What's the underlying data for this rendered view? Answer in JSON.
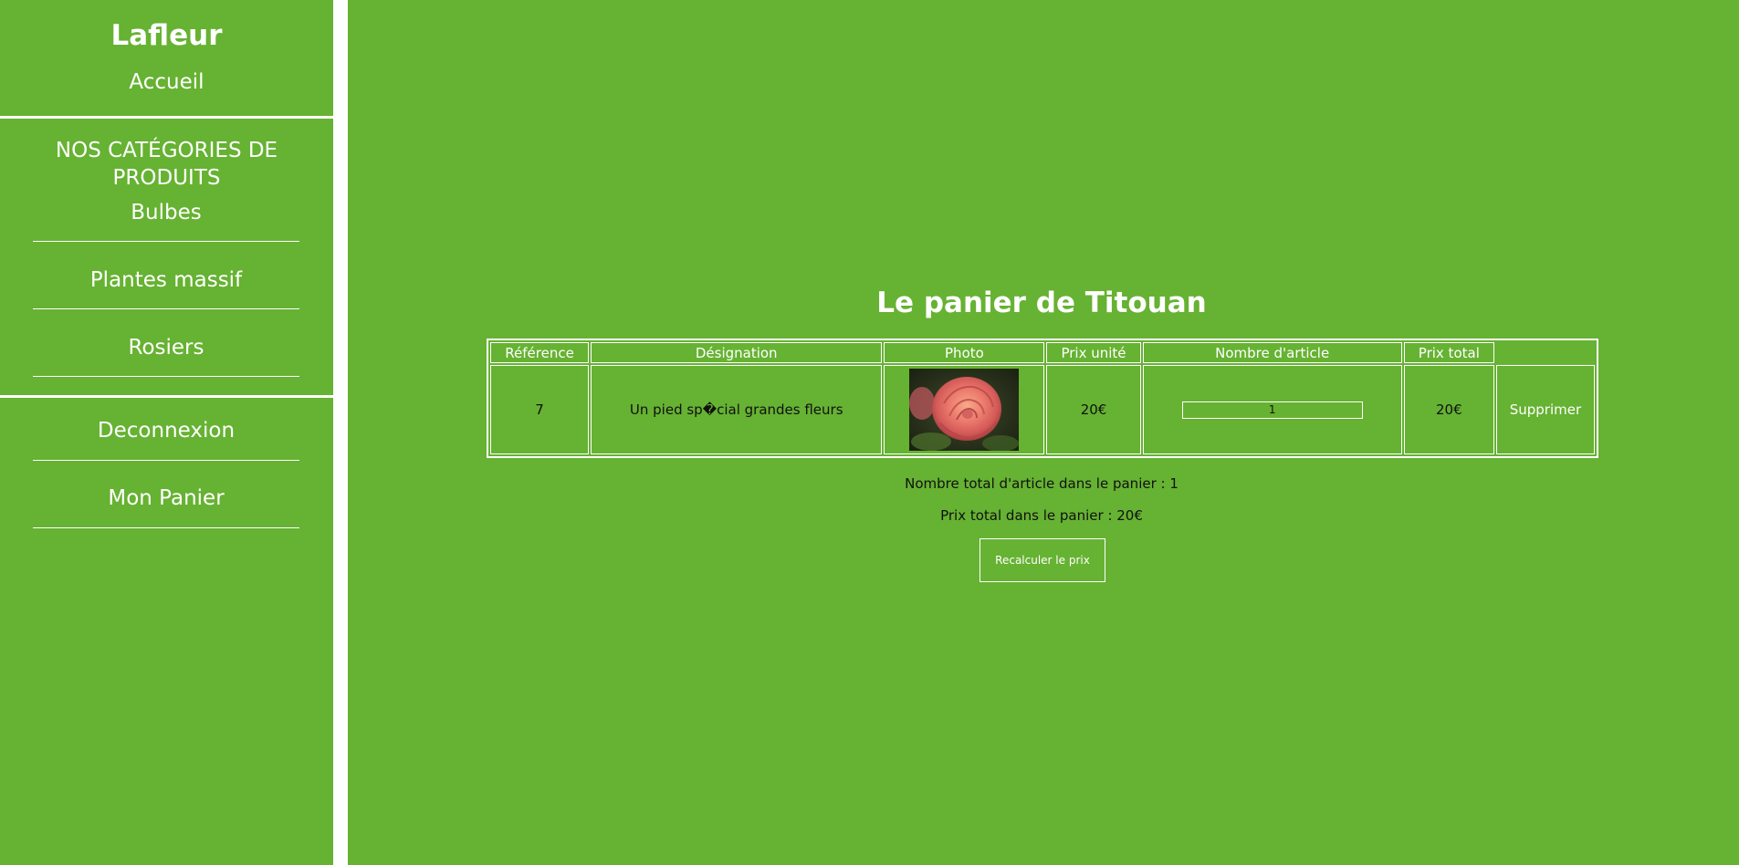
{
  "sidebar": {
    "brand": "Lafleur",
    "home": "Accueil",
    "categories_title": "NOS CATÉGORIES DE PRODUITS",
    "categories": [
      "Bulbes",
      "Plantes massif",
      "Rosiers"
    ],
    "logout": "Deconnexion",
    "cart": "Mon Panier"
  },
  "main": {
    "title": "Le panier de Titouan",
    "table": {
      "headers": [
        "Référence",
        "Désignation",
        "Photo",
        "Prix unité",
        "Nombre d'article",
        "Prix total"
      ],
      "rows": [
        {
          "reference": "7",
          "designation": "Un pied sp�cial grandes fleurs",
          "unit_price": "20€",
          "quantity": "1",
          "total_price": "20€",
          "delete_label": "Supprimer"
        }
      ]
    },
    "total_items": "Nombre total d'article dans le panier : 1",
    "total_price": "Prix total dans le panier : 20€",
    "recalc_button": "Recalculer le prix"
  },
  "colors": {
    "background": "#66b232",
    "accent": "#ffffff"
  }
}
